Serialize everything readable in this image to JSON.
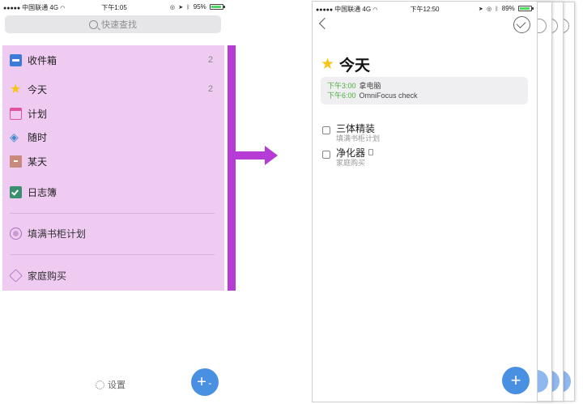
{
  "left_screen": {
    "status_bar": {
      "carrier": "中国联通",
      "network": "4G",
      "time": "下午1:05",
      "battery": "95%",
      "battery_level": 0.95
    },
    "search": {
      "placeholder": "快速查找"
    },
    "perspectives": [
      {
        "label": "收件箱",
        "count": "2",
        "icon": "inbox-icon"
      },
      {
        "label": "今天",
        "count": "2",
        "icon": "star-icon"
      },
      {
        "label": "计划",
        "count": "",
        "icon": "calendar-icon"
      },
      {
        "label": "随时",
        "count": "",
        "icon": "layers-icon"
      },
      {
        "label": "某天",
        "count": "",
        "icon": "archive-icon"
      },
      {
        "label": "日志簿",
        "count": "",
        "icon": "journal-icon"
      }
    ],
    "projects": [
      {
        "label": "填满书柜计划",
        "icon": "project-icon"
      }
    ],
    "tags": [
      {
        "label": "家庭购买",
        "icon": "cube-icon"
      }
    ],
    "footer": {
      "settings_label": "设置",
      "add_label": "+"
    }
  },
  "right_screen": {
    "status_bar": {
      "carrier": "中国联通",
      "network": "4G",
      "time": "下午12:50",
      "battery": "89%",
      "battery_level": 0.89
    },
    "title": "今天",
    "events": [
      {
        "time": "下午3:00",
        "name": "拿电脑"
      },
      {
        "time": "下午6:00",
        "name": "OmniFocus check"
      }
    ],
    "tasks": [
      {
        "name": "三体精装",
        "project": "填满书柜计划"
      },
      {
        "name": "净化器",
        "project": "家庭购买"
      }
    ],
    "add_label": "+"
  },
  "colors": {
    "highlight": "#efcaf1",
    "arrow": "#b63cd6",
    "accent": "#4a90e2",
    "event_time": "#4fae3c"
  }
}
